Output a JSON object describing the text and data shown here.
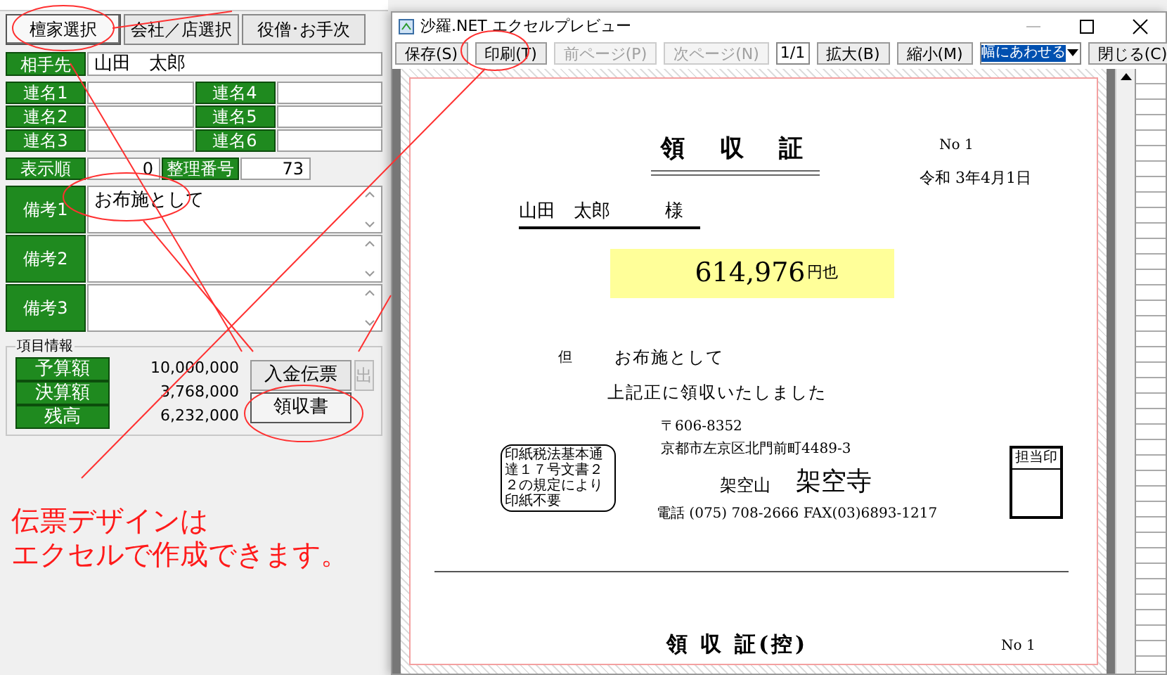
{
  "left": {
    "buttons": [
      {
        "label": "檀家選択",
        "selected": true
      },
      {
        "label": "会社／店選択",
        "selected": false
      },
      {
        "label": "役僧･お手次",
        "selected": false
      }
    ],
    "partner": {
      "label": "相手先",
      "value": "山田　太郎"
    },
    "joint_names": [
      {
        "label": "連名1"
      },
      {
        "label": "連名4"
      },
      {
        "label": "連名2"
      },
      {
        "label": "連名5"
      },
      {
        "label": "連名3"
      },
      {
        "label": "連名6"
      }
    ],
    "display_order": {
      "label": "表示順",
      "value": "0"
    },
    "ref_number": {
      "label": "整理番号",
      "value": "73"
    },
    "notes": [
      {
        "label": "備考1",
        "value": "お布施として"
      },
      {
        "label": "備考2"
      },
      {
        "label": "備考3"
      }
    ],
    "item_info": {
      "title": "項目情報",
      "rows": [
        {
          "label": "予算額",
          "value": "10,000,000"
        },
        {
          "label": "決算額",
          "value": "3,768,000"
        },
        {
          "label": "残高",
          "value": "6,232,000"
        }
      ],
      "buttons": [
        {
          "label": "入金伝票"
        },
        {
          "label": "領収書"
        },
        {
          "label": "出"
        }
      ]
    }
  },
  "annotation": {
    "lines": [
      "伝票デザインは",
      "エクセルで作成できます。"
    ]
  },
  "preview": {
    "window": {
      "title": "沙羅.NET エクセルプレビュー"
    },
    "toolbar": [
      {
        "kind": "button",
        "label": "保存(S)",
        "disabled": false
      },
      {
        "kind": "button",
        "label": "印刷(T)",
        "disabled": false
      },
      {
        "kind": "button",
        "label": "前ページ(P)",
        "disabled": true
      },
      {
        "kind": "button",
        "label": "次ページ(N)",
        "disabled": true
      },
      {
        "kind": "field",
        "value": "1/1"
      },
      {
        "kind": "button",
        "label": "拡大(B)",
        "disabled": false
      },
      {
        "kind": "button",
        "label": "縮小(M)",
        "disabled": false
      },
      {
        "kind": "select",
        "value": "幅にあわせる"
      },
      {
        "kind": "button",
        "label": "閉じる(C)",
        "disabled": false
      }
    ],
    "document": {
      "title": "領　収　証",
      "number": "No 1",
      "date": "令和 3年4月1日",
      "recipient": "山田　太郎　　　様",
      "amount": "614,976",
      "amount_suffix": "円也",
      "proviso_label": "但",
      "proviso": "お布施として",
      "received": "上記正に領収いたしました",
      "postal": "〒606-8352",
      "address": "京都市左京区北門前町4489-3",
      "mountain": "架空山",
      "temple": "架空寺",
      "phone": "電話 (075) 708-2666 FAX(03)6893-1217",
      "stamp_note": "印紙税法基本通達１７号文書２２の規定により印紙不要",
      "seal_label": "担当印",
      "copy_title": "領 収 証(控)",
      "copy_number": "No 1"
    }
  }
}
